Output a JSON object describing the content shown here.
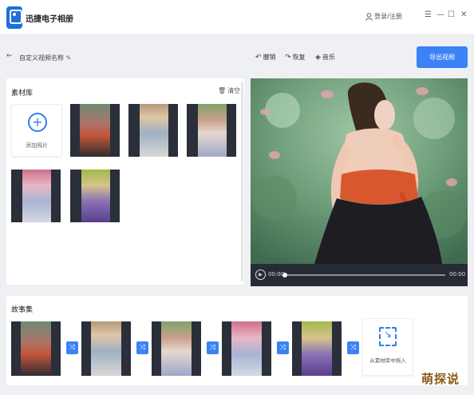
{
  "app": {
    "title": "迅捷电子相册",
    "login_label": "登录/注册"
  },
  "window_controls": {
    "menu": "☰",
    "minimize": "—",
    "maximize": "☐",
    "close": "✕"
  },
  "toolbar": {
    "back": "←",
    "project_name": "自定义视频名称",
    "undo_label": "撤销",
    "redo_label": "恢复",
    "music_label": "音乐",
    "export_label": "导出视频"
  },
  "library": {
    "title": "素材库",
    "clear_label": "清空",
    "add_label": "添加照片",
    "thumbs": 6
  },
  "player": {
    "current_time": "00:00",
    "total_time": "00:00",
    "progress": 0
  },
  "storyboard": {
    "title": "故事集",
    "drop_label": "从素材库中拖入",
    "transition_icon": "⤨"
  },
  "colors": {
    "accent": "#3b82f6",
    "brand": "#1f6fd6"
  },
  "watermark": "萌探说"
}
